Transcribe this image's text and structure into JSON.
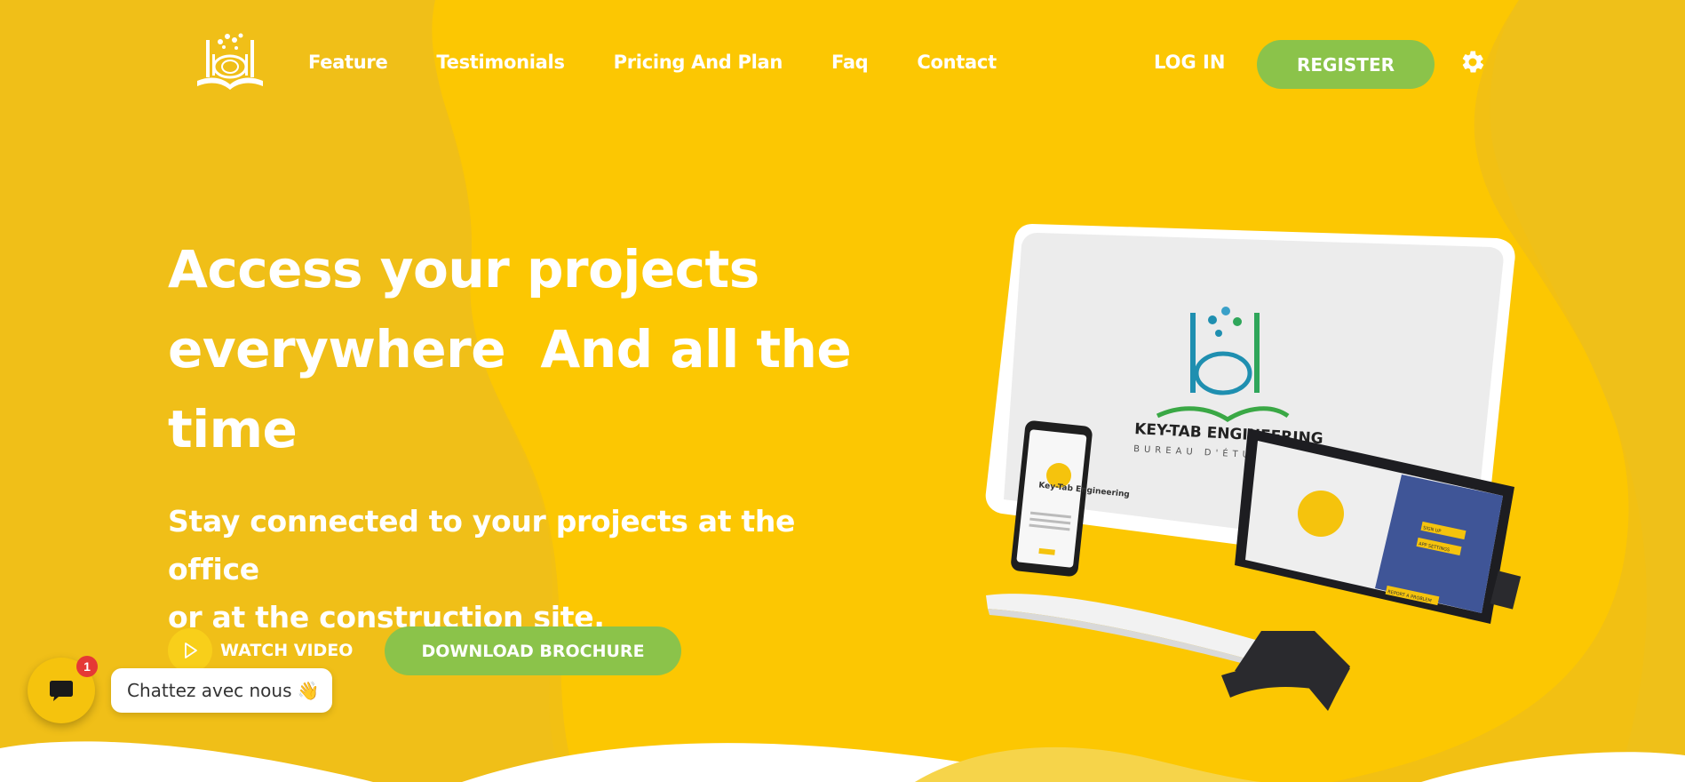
{
  "nav": {
    "links": [
      "Feature",
      "Testimonials",
      "Pricing And Plan",
      "Faq",
      "Contact"
    ],
    "login_label": "LOG IN",
    "register_label": "REGISTER"
  },
  "hero": {
    "title_line1": "Access your projects",
    "title_line2": "everywhere  And all the",
    "title_line3": "time",
    "subtitle_line1": "Stay connected to your projects at the office",
    "subtitle_line2": "or at the construction site.",
    "watch_video_label": "WATCH VIDEO",
    "download_label": "DOWNLOAD BROCHURE"
  },
  "illustration": {
    "brand_main": "KEY-TAB ENGINEERING",
    "brand_sub": "BUREAU D'ÉTUDE",
    "phone_text": "Key-Tab Engineering",
    "tablet_btn1": "SIGN UP",
    "tablet_btn2": "APP SETTINGS",
    "tablet_btn3": "REPORT A PROBLEM"
  },
  "chat": {
    "badge_count": "1",
    "label": "Chattez avec nous",
    "wave_emoji": "👋"
  },
  "colors": {
    "primary_yellow": "#f5c30d",
    "accent_green": "#8bc34a",
    "text_white": "#ffffff",
    "badge_red": "#e53935"
  },
  "icons": {
    "logo": "keytab-logo-icon",
    "settings": "gear-icon",
    "play": "play-icon",
    "chat": "chat-icon"
  }
}
